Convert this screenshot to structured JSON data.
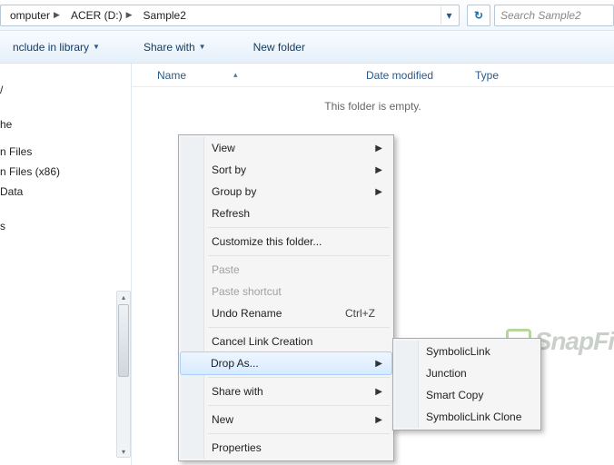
{
  "breadcrumb": {
    "items": [
      "omputer",
      "ACER (D:)",
      "Sample2"
    ]
  },
  "addressbar": {
    "search_placeholder": "Search Sample2"
  },
  "toolbar": {
    "include": "nclude in library",
    "share": "Share with",
    "newfolder": "New folder"
  },
  "sidebar": {
    "items": [
      "",
      "/",
      "",
      "",
      "he",
      "",
      "n Files",
      "n Files (x86)",
      "Data",
      "",
      "",
      "s",
      ""
    ]
  },
  "columns": {
    "name": "Name",
    "date": "Date modified",
    "type": "Type"
  },
  "empty": "This folder is empty.",
  "ctx": {
    "view": "View",
    "sortby": "Sort by",
    "groupby": "Group by",
    "refresh": "Refresh",
    "customize": "Customize this folder...",
    "paste": "Paste",
    "paste_shortcut": "Paste shortcut",
    "undo": "Undo Rename",
    "undo_key": "Ctrl+Z",
    "cancel_link": "Cancel Link Creation",
    "drop_as": "Drop As...",
    "share_with": "Share with",
    "new": "New",
    "properties": "Properties"
  },
  "submenu": {
    "symlink": "SymbolicLink",
    "junction": "Junction",
    "smartcopy": "Smart Copy",
    "symlink_clone": "SymbolicLink Clone"
  },
  "watermark": "SnapFi"
}
